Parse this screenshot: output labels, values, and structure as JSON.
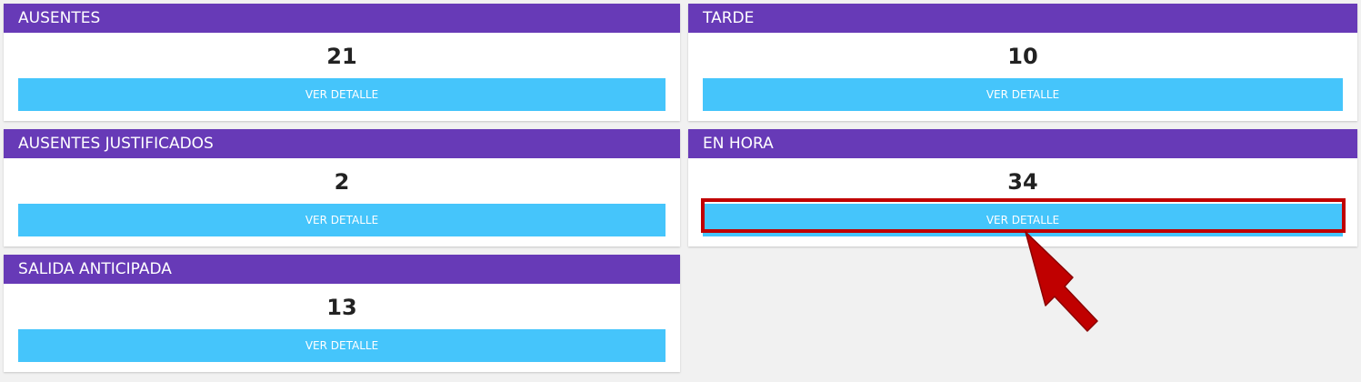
{
  "colors": {
    "header_bg": "#673ab7",
    "button_bg": "#45c5fb",
    "highlight": "#c00000"
  },
  "cards": [
    {
      "title": "AUSENTES",
      "value": "21",
      "button_label": "VER DETALLE"
    },
    {
      "title": "TARDE",
      "value": "10",
      "button_label": "VER DETALLE"
    },
    {
      "title": "AUSENTES JUSTIFICADOS",
      "value": "2",
      "button_label": "VER DETALLE"
    },
    {
      "title": "EN HORA",
      "value": "34",
      "button_label": "VER DETALLE",
      "highlighted": true
    },
    {
      "title": "SALIDA ANTICIPADA",
      "value": "13",
      "button_label": "VER DETALLE"
    }
  ],
  "annotation": {
    "icon": "red-arrow-pointer-icon"
  }
}
